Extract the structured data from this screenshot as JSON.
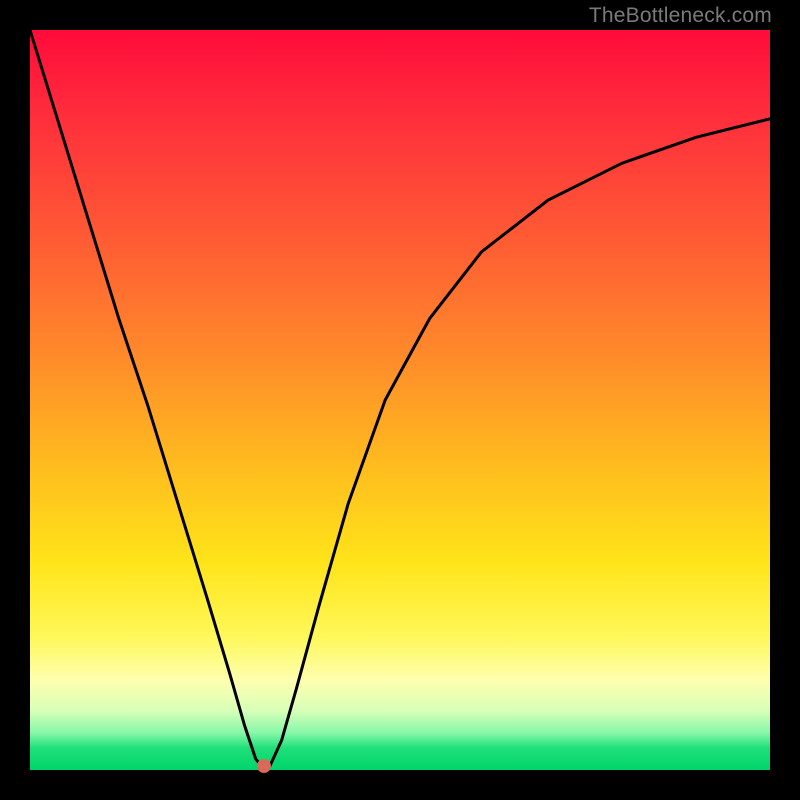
{
  "watermark": {
    "text": "TheBottleneck.com"
  },
  "colors": {
    "gradient_top": "#ff0b3a",
    "gradient_mid1": "#ff8a2a",
    "gradient_mid2": "#ffe419",
    "gradient_bottom": "#00d46a",
    "curve": "#000000",
    "dot": "#d96a5a",
    "frame": "#000000"
  },
  "chart_data": {
    "type": "line",
    "title": "",
    "xlabel": "",
    "ylabel": "",
    "xlim": [
      0,
      100
    ],
    "ylim": [
      0,
      100
    ],
    "grid": false,
    "legend": false,
    "series": [
      {
        "name": "curve",
        "x": [
          0,
          4,
          8,
          12,
          16,
          20,
          24,
          27,
          29,
          30.5,
          31.3,
          32.4,
          34,
          36,
          39,
          43,
          48,
          54,
          61,
          70,
          80,
          90,
          100
        ],
        "y": [
          100,
          87,
          74,
          61,
          49,
          36,
          23,
          13,
          6,
          1.5,
          0.5,
          0.5,
          4,
          11,
          22,
          36,
          50,
          61,
          70,
          77,
          82,
          85.5,
          88
        ]
      }
    ],
    "marker": {
      "x": 31.6,
      "y": 0.6
    },
    "notes": "V-shaped bottleneck curve; minimum at ~x=31.6, y≈0.6; left branch linear descent from (0,100); right branch asymptotic rise toward ~88"
  }
}
